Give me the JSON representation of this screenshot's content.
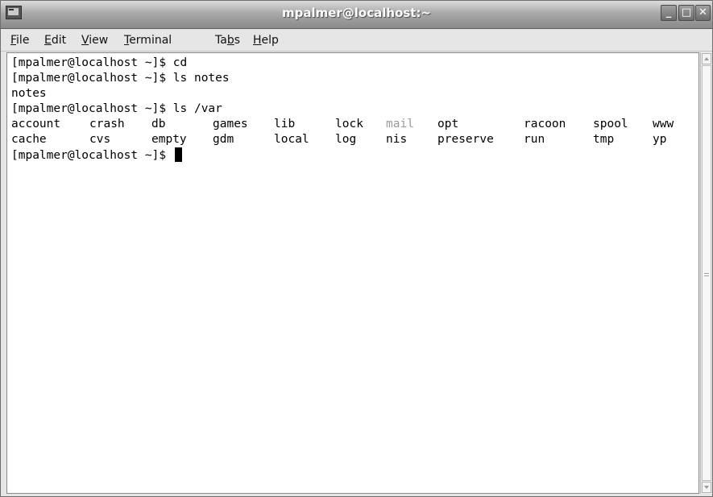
{
  "window": {
    "title": "mpalmer@localhost:~",
    "controls": {
      "minimize": "_",
      "maximize": "□",
      "close": "✕"
    }
  },
  "menu": {
    "items": [
      {
        "mnemonic": "F",
        "rest": "ile"
      },
      {
        "mnemonic": "E",
        "rest": "dit"
      },
      {
        "mnemonic": "V",
        "rest": "iew"
      },
      {
        "mnemonic": "T",
        "rest": "erminal"
      },
      {
        "pre": "Ta",
        "mnemonic": "b",
        "rest": "s"
      },
      {
        "mnemonic": "H",
        "rest": "elp"
      }
    ]
  },
  "terminal": {
    "lines": [
      "[mpalmer@localhost ~]$ cd",
      "[mpalmer@localhost ~]$ ls notes",
      "notes",
      "[mpalmer@localhost ~]$ ls /var"
    ],
    "ls_row1": [
      "account",
      "crash",
      "db",
      "games",
      "lib",
      "lock",
      "mail",
      "opt",
      "racoon",
      "spool",
      "www"
    ],
    "ls_row2": [
      "cache",
      "cvs",
      "empty",
      "gdm",
      "local",
      "log",
      "nis",
      "preserve",
      "run",
      "tmp",
      "yp"
    ],
    "prompt": "[mpalmer@localhost ~]$ ",
    "colors": {
      "text": "#000000",
      "dimmed": "#9a9a9a",
      "background": "#ffffff"
    }
  }
}
